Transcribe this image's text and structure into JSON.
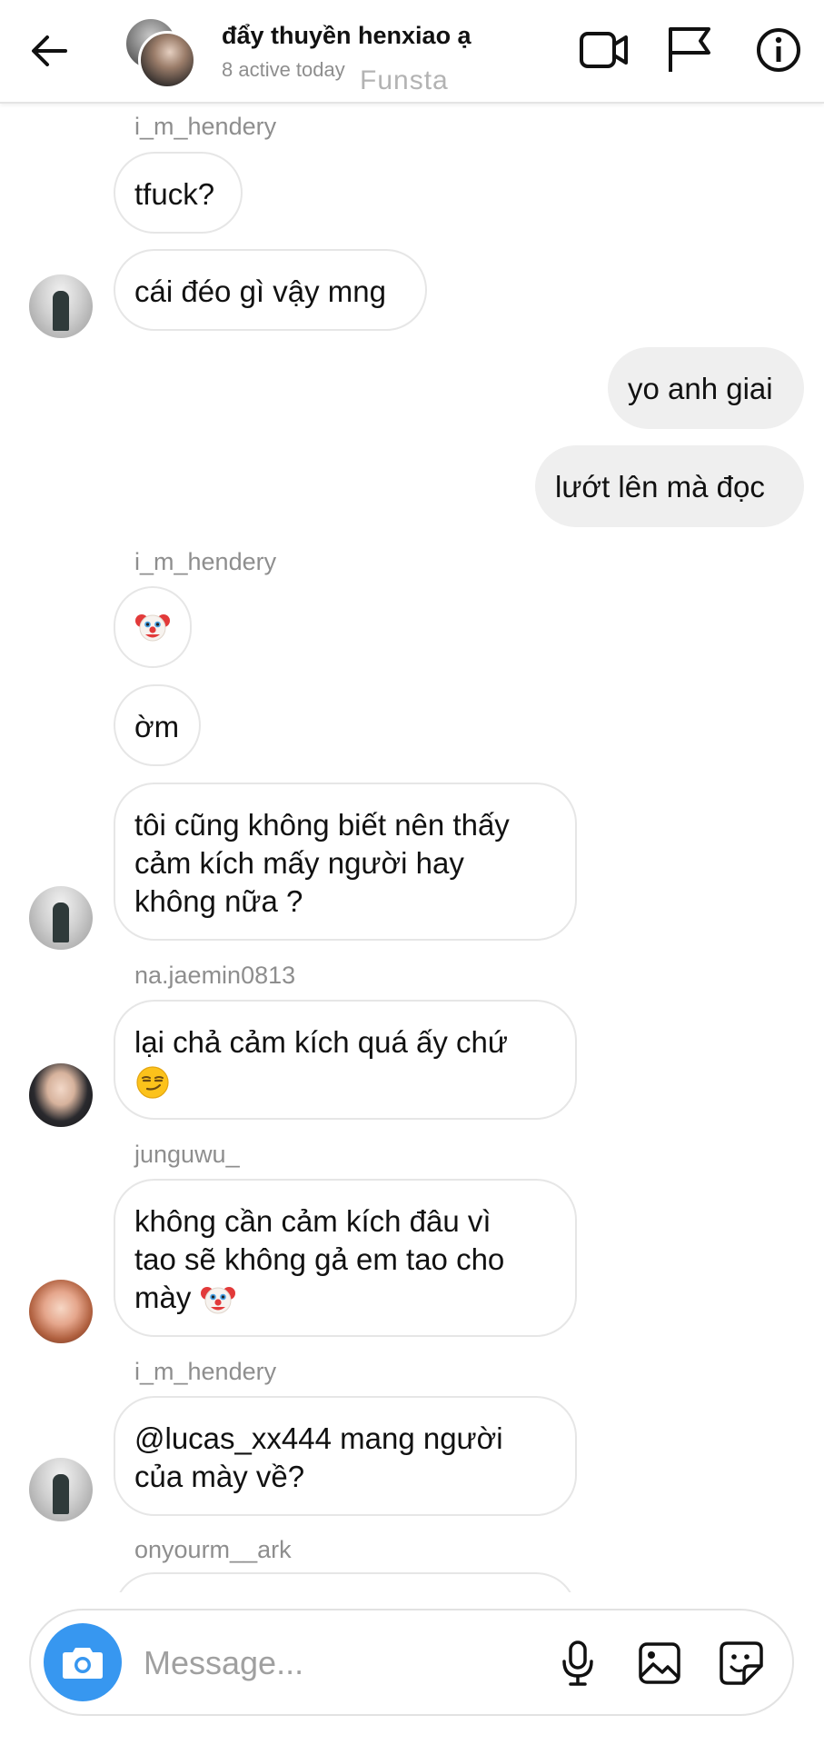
{
  "header": {
    "title": "đẩy thuyền henxiao ạ",
    "subtitle": "8 active today",
    "watermark": "Funsta",
    "icons": [
      "back-arrow-icon",
      "video-call-icon",
      "flag-icon",
      "info-icon"
    ]
  },
  "messages": [
    {
      "sender": "i_m_hendery",
      "text": "tfuck?",
      "direction": "incoming"
    },
    {
      "text": "cái đéo gì vậy mng",
      "direction": "incoming",
      "avatar": "i_m_hendery"
    },
    {
      "text": "yo anh giai",
      "direction": "outgoing"
    },
    {
      "text": "lướt lên mà đọc",
      "direction": "outgoing"
    },
    {
      "sender": "i_m_hendery",
      "emoji": "clown-face",
      "direction": "incoming"
    },
    {
      "text": "ờm",
      "direction": "incoming"
    },
    {
      "line1": "tôi cũng không biết nên thấy",
      "line2": "cảm kích mấy người hay",
      "line3": "không nữa ?",
      "direction": "incoming",
      "avatar": "i_m_hendery"
    },
    {
      "sender": "na.jaemin0813",
      "line1": "lại chả cảm kích quá ấy chứ",
      "emoji": "smirking-face",
      "direction": "incoming",
      "avatar": "na.jaemin0813"
    },
    {
      "sender": "junguwu_",
      "line1": "không cần cảm kích đâu vì",
      "line2": "tao sẽ không gả em tao cho",
      "line3": "mày",
      "emoji": "clown-face",
      "direction": "incoming",
      "avatar": "junguwu_"
    },
    {
      "sender": "i_m_hendery",
      "line1": "@lucas_xx444 mang người",
      "line2": "của mày về?",
      "direction": "incoming",
      "avatar": "i_m_hendery"
    },
    {
      "sender": "onyourm__ark",
      "direction": "incoming",
      "partial": true
    }
  ],
  "composer": {
    "placeholder": "Message...",
    "icons": [
      "camera-icon",
      "microphone-icon",
      "gallery-icon",
      "sticker-icon"
    ]
  },
  "colors": {
    "accent": "#3797f0",
    "outgoing_bubble": "#efefef",
    "incoming_border": "#e6e6e6",
    "muted_text": "#8e8e8e"
  }
}
